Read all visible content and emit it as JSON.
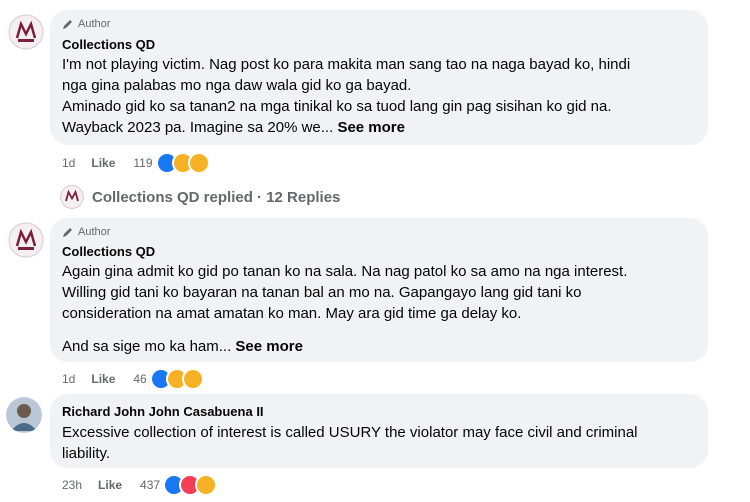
{
  "comments": [
    {
      "badge": "Author",
      "name": "Collections QD",
      "lines": [
        "I'm not playing victim. Nag post ko para makita man sang tao na naga bayad ko, hindi",
        "nga gina palabas mo nga daw wala gid ko ga bayad.",
        "Aminado gid ko sa tanan2 na mga tinikal ko sa tuod lang gin pag sisihan ko gid na.",
        "Wayback 2023 pa. Imagine sa 20% we..."
      ],
      "see_more": "See more",
      "time": "1d",
      "like_label": "Like",
      "reaction_count": "119"
    },
    {
      "badge": "Author",
      "name": "Collections QD",
      "lines": [
        "Again gina admit ko gid po tanan ko na sala. Na nag patol ko sa amo na nga interest.",
        "Willing gid tani ko bayaran na tanan bal an mo na. Gapangayo lang gid tani ko",
        "consideration na amat amatan ko man. May ara gid time ga delay ko.",
        "And sa sige mo ka ham..."
      ],
      "see_more": "See more",
      "time": "1d",
      "like_label": "Like",
      "reaction_count": "46"
    },
    {
      "name": "Richard John John Casabuena II",
      "lines": [
        "Excessive collection of interest is called USURY the violator may face civil and criminal",
        "liability."
      ],
      "time": "23h",
      "like_label": "Like",
      "reaction_count": "437"
    }
  ],
  "replies": {
    "text": "Collections QD replied · 12 Replies"
  },
  "colors": {
    "bubble": "#f0f2f5",
    "secondary_text": "#65676b",
    "like_blue": "#1877f2",
    "love_red": "#f33e58",
    "emoji_yellow": "#f7b125"
  }
}
